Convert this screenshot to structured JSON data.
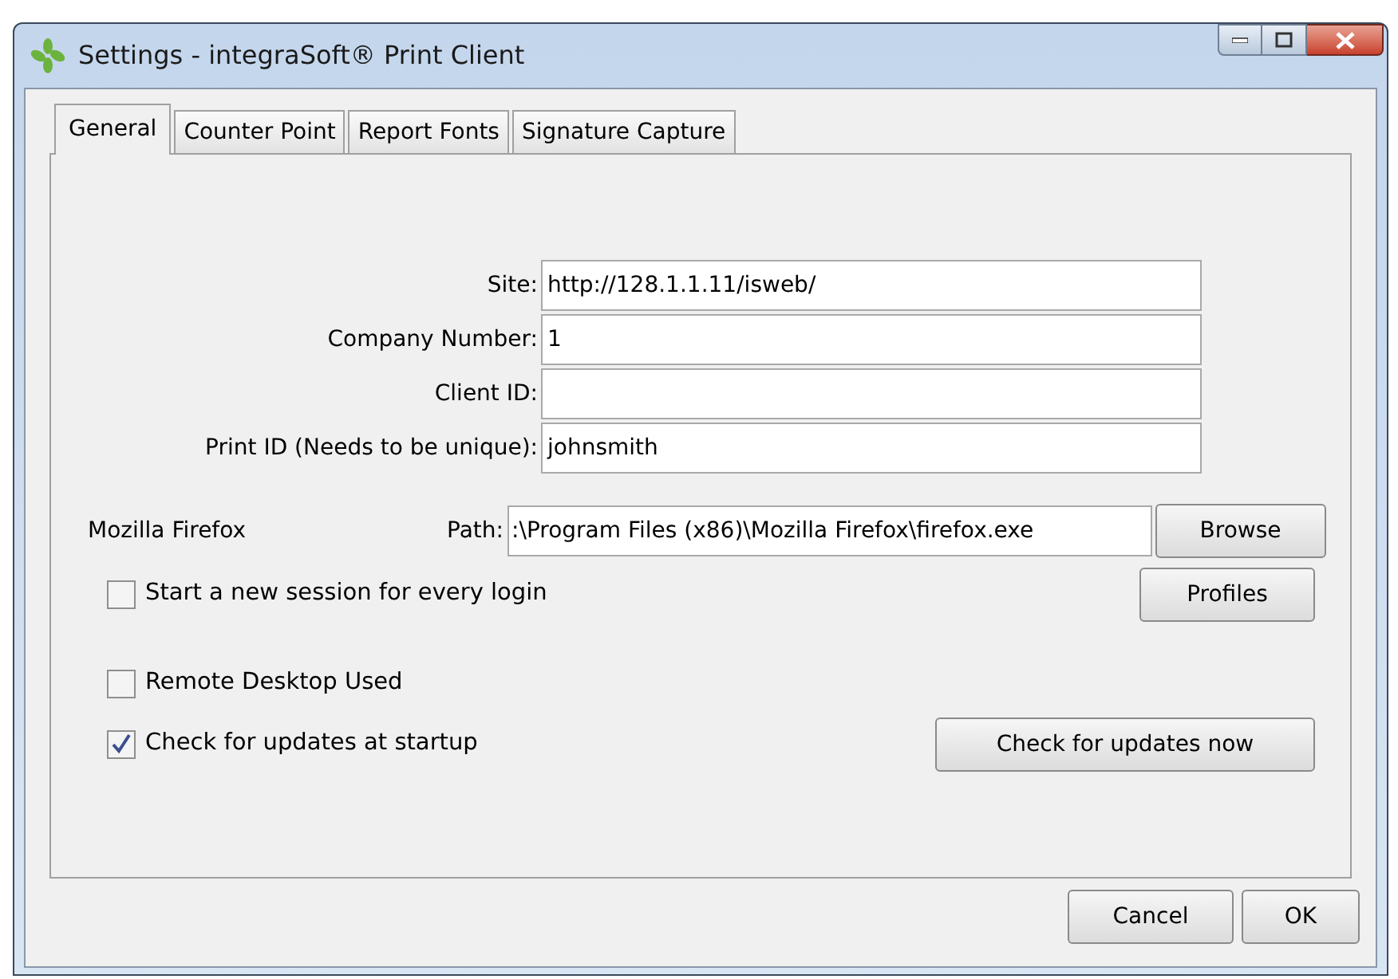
{
  "window": {
    "title": "Settings - integraSoft® Print Client"
  },
  "tabs": [
    {
      "label": "General",
      "selected": true
    },
    {
      "label": "Counter Point",
      "selected": false
    },
    {
      "label": "Report Fonts",
      "selected": false
    },
    {
      "label": "Signature Capture",
      "selected": false
    }
  ],
  "fields": [
    {
      "label": "Site:",
      "value": "http://128.1.1.11/isweb/"
    },
    {
      "label": "Company Number:",
      "value": "1"
    },
    {
      "label": "Client ID:"
    },
    {
      "label": "Print ID (Needs to be unique):",
      "value": "johnsmith"
    }
  ],
  "browser": {
    "name": "Mozilla Firefox",
    "path_label": "Path:",
    "path": ":\\Program Files (x86)\\Mozilla Firefox\\firefox.exe",
    "browse_button": "Browse",
    "profiles_button": "Profiles"
  },
  "new_session": {
    "label": "Start a new session for every login",
    "checked": false
  },
  "remote_desktop": {
    "label": "Remote Desktop Used",
    "checked": false
  },
  "check_updates": {
    "label": "Check for updates at startup",
    "checked": true
  },
  "check_now_button": "Check for updates now",
  "buttons": [
    "Cancel",
    "OK"
  ]
}
